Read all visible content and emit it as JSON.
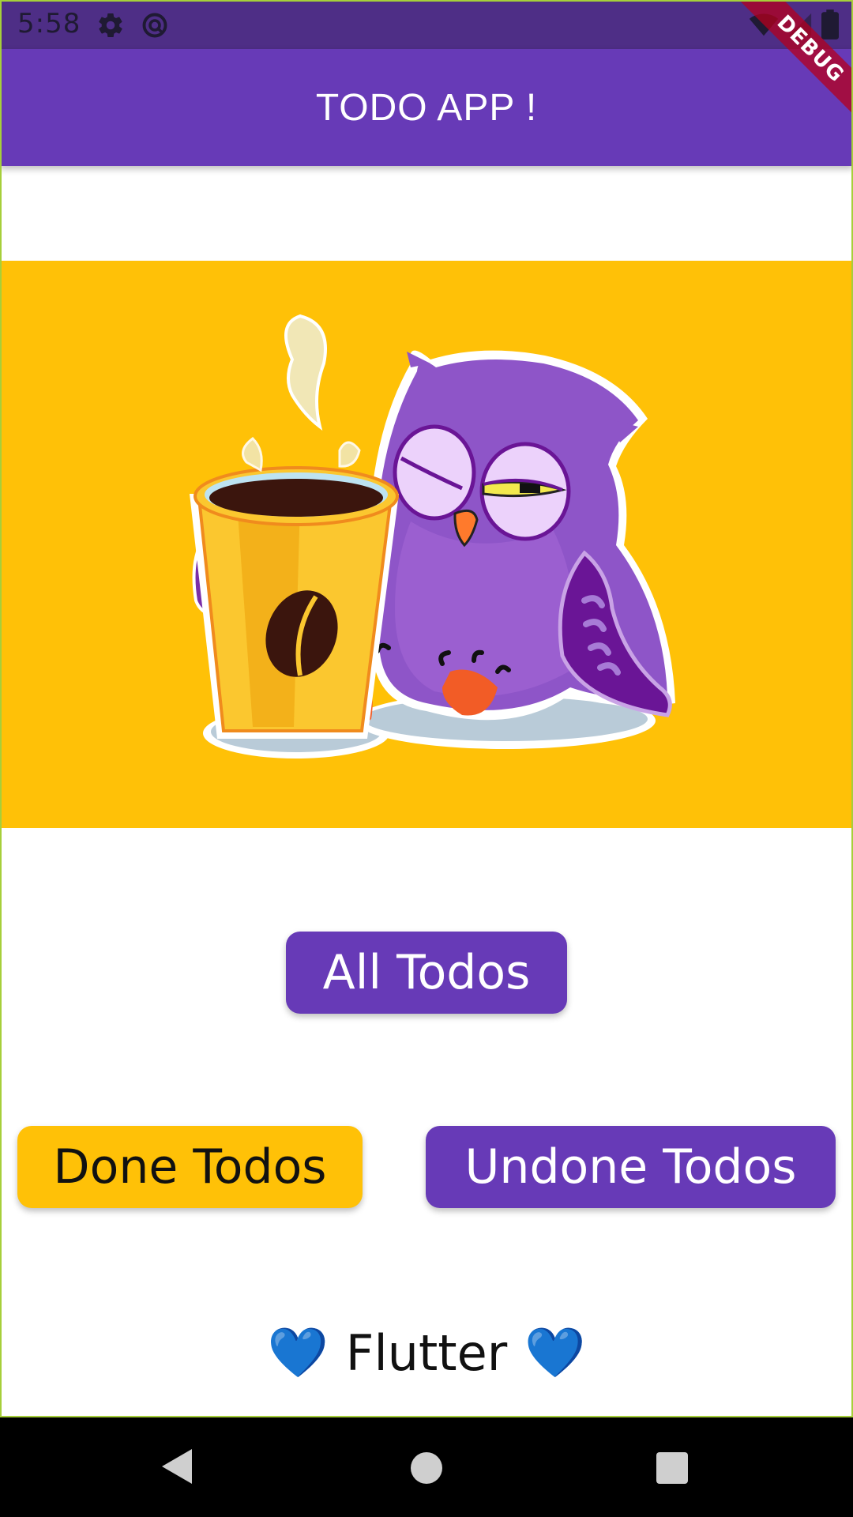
{
  "status_bar": {
    "time": "5:58",
    "icons": [
      "settings-gear-icon",
      "data-saver-icon",
      "wifi-icon",
      "signal-icon",
      "battery-icon"
    ]
  },
  "debug_banner": "DEBUG",
  "app_bar": {
    "title": "TODO APP !"
  },
  "hero": {
    "illustration": "sleepy-owl-with-coffee-cup",
    "background_color": "#ffc107"
  },
  "buttons": {
    "all": "All Todos",
    "done": "Done Todos",
    "undone": "Undone Todos"
  },
  "footer": {
    "heart_left": "💙",
    "text": "Flutter",
    "heart_right": "💙"
  },
  "colors": {
    "primary": "#673ab7",
    "accent": "#ffc107",
    "status_bar": "#4e2e86"
  },
  "nav_bar": {
    "icons": [
      "back-icon",
      "home-icon",
      "recents-icon"
    ]
  }
}
